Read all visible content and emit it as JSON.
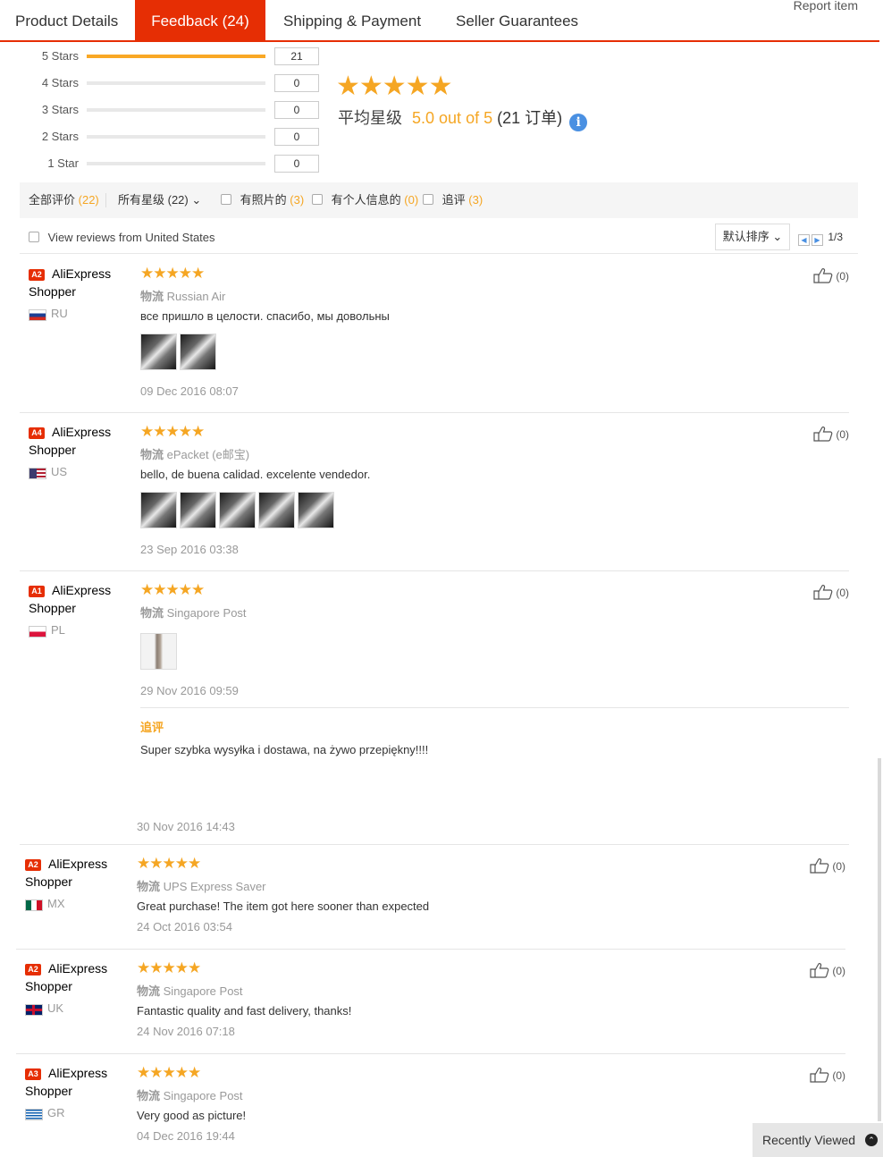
{
  "tabs": {
    "product_details": "Product Details",
    "feedback": "Feedback (24)",
    "shipping": "Shipping & Payment",
    "seller": "Seller Guarantees",
    "report": "Report item"
  },
  "histogram": [
    {
      "label": "5 Stars",
      "count": "21",
      "fraction": 1.0
    },
    {
      "label": "4 Stars",
      "count": "0",
      "fraction": 0
    },
    {
      "label": "3 Stars",
      "count": "0",
      "fraction": 0
    },
    {
      "label": "2 Stars",
      "count": "0",
      "fraction": 0
    },
    {
      "label": "1 Star",
      "count": "0",
      "fraction": 0
    }
  ],
  "summary": {
    "stars": "★★★★★",
    "avg_label": "平均星级",
    "avg_score": "5.0 out of 5",
    "orders": "(21 订单)",
    "info": "i"
  },
  "filters": {
    "all_label": "全部评价",
    "all_count": "(22)",
    "rating_select": "所有星级 (22)",
    "rating_chevron": "⌄",
    "photo_label": "有照片的",
    "photo_count": "(3)",
    "personal_label": "有个人信息的",
    "personal_count": "(0)",
    "additional_label": "追评",
    "additional_count": "(3)"
  },
  "region": {
    "label": "View reviews from United States",
    "sort": "默认排序",
    "sort_chevron": "⌄",
    "prev": "◀",
    "next": "▶",
    "page": "1/3"
  },
  "reviews": [
    {
      "badge": "A2",
      "name": "AliExpress",
      "type": "Shopper",
      "country": "RU",
      "stars": "★★★★★",
      "ship_label": "物流",
      "ship": "Russian Air",
      "text": "все пришло в целости. спасибо, мы довольны",
      "date": "09 Dec 2016 08:07",
      "helpful": "(0)"
    },
    {
      "badge": "A4",
      "name": "AliExpress",
      "type": "Shopper",
      "country": "US",
      "stars": "★★★★★",
      "ship_label": "物流",
      "ship": "ePacket (e邮宝)",
      "text": "bello, de buena calidad. excelente vendedor.",
      "date": "23 Sep 2016 03:38",
      "helpful": "(0)"
    },
    {
      "badge": "A1",
      "name": "AliExpress",
      "type": "Shopper",
      "country": "PL",
      "stars": "★★★★★",
      "ship_label": "物流",
      "ship": "Singapore Post",
      "text": "",
      "date": "29 Nov 2016 09:59",
      "helpful": "(0)",
      "add_title": "追评",
      "add_text": "Super szybka wysyłka i dostawa, na żywo przepiękny!!!!",
      "add_date": "30 Nov 2016 14:43"
    },
    {
      "badge": "A2",
      "name": "AliExpress",
      "type": "Shopper",
      "country": "MX",
      "stars": "★★★★★",
      "ship_label": "物流",
      "ship": "UPS Express Saver",
      "text": "Great purchase! The item got here sooner than expected",
      "date": "24 Oct 2016 03:54",
      "helpful": "(0)"
    },
    {
      "badge": "A2",
      "name": "AliExpress",
      "type": "Shopper",
      "country": "UK",
      "stars": "★★★★★",
      "ship_label": "物流",
      "ship": "Singapore Post",
      "text": "Fantastic quality and fast delivery, thanks!",
      "date": "24 Nov 2016 07:18",
      "helpful": "(0)"
    },
    {
      "badge": "A3",
      "name": "AliExpress",
      "type": "Shopper",
      "country": "GR",
      "stars": "★★★★★",
      "ship_label": "物流",
      "ship": "Singapore Post",
      "text": "Very good as picture!",
      "date": "04 Dec 2016 19:44",
      "helpful": "(0)"
    }
  ],
  "recently_viewed": {
    "label": "Recently Viewed",
    "icon": "⌃"
  }
}
